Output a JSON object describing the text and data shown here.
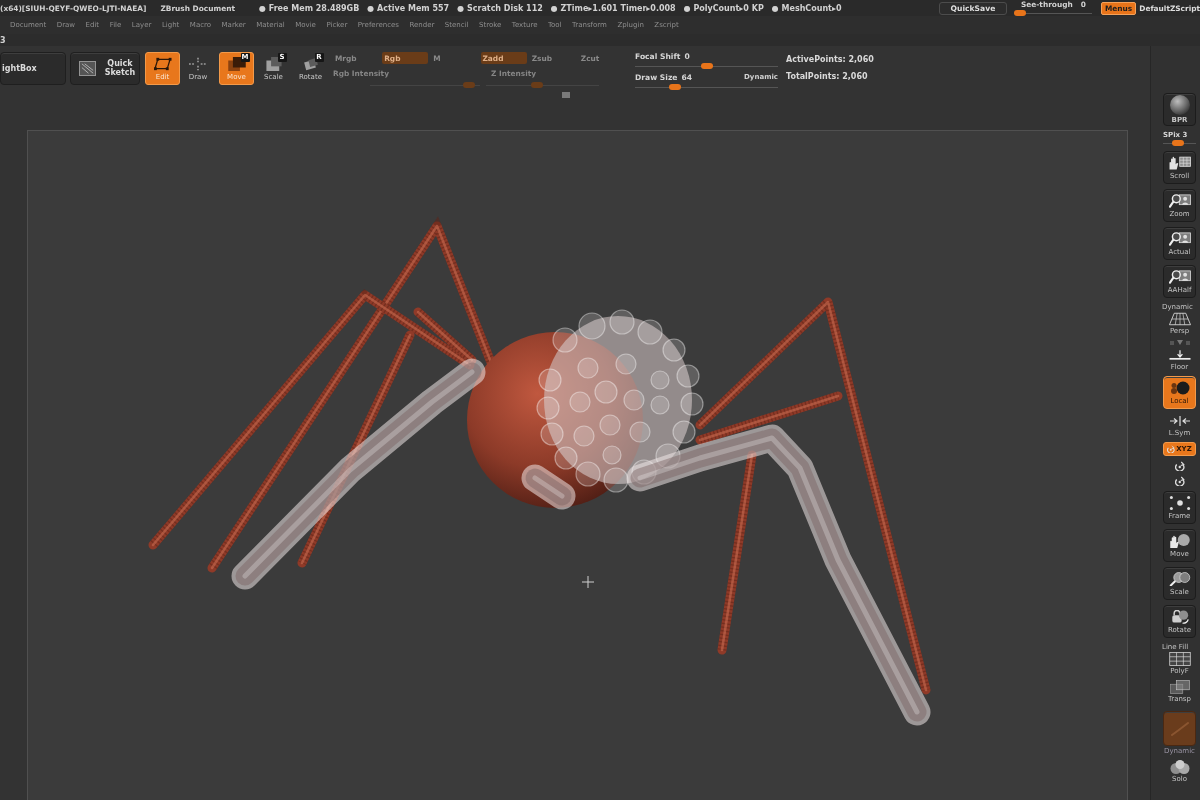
{
  "title_bar": {
    "license": "(x64)[SIUH-QEYF-QWEO-LJTI-NAEA]",
    "document": "ZBrush Document",
    "stats": [
      "● Free Mem 28.489GB",
      "● Active Mem 557",
      "● Scratch Disk 112",
      "● ZTime▸1.601 Timer▸0.008",
      "● PolyCount▸0 KP",
      "● MeshCount▸0"
    ],
    "quicksave": "QuickSave",
    "see_through": {
      "label": "See-through",
      "value": "0",
      "level": 0
    },
    "menus_toggle": {
      "label": "Menus",
      "on": true
    },
    "script": "DefaultZScript"
  },
  "menu_bar": {
    "items": [
      "Document",
      "Draw",
      "Edit",
      "File",
      "Layer",
      "Light",
      "Macro",
      "Marker",
      "Material",
      "Movie",
      "Picker",
      "Preferences",
      "Render",
      "Stencil",
      "Stroke",
      "Texture",
      "Tool",
      "Transform",
      "Zplugin",
      "Zscript"
    ]
  },
  "sub_palette": {
    "text": "3"
  },
  "toolbar": {
    "lightbox": "ightBox",
    "quick_sketch": "Quick Sketch",
    "modes": [
      {
        "kind": "edit",
        "label": "Edit",
        "selected": true
      },
      {
        "kind": "draw",
        "label": "Draw",
        "selected": false
      },
      {
        "kind": "move",
        "label": "Move",
        "hotkey": "M",
        "selected": true
      },
      {
        "kind": "scale",
        "label": "Scale",
        "hotkey": "S",
        "selected": false
      },
      {
        "kind": "rotate",
        "label": "Rotate",
        "hotkey": "R",
        "selected": false
      }
    ],
    "paint_group": {
      "disabled": true,
      "modes": [
        {
          "label": "Mrgb",
          "selected": false
        },
        {
          "label": "Rgb",
          "selected": true
        },
        {
          "label": "M",
          "selected": false
        },
        {
          "label": "Zadd",
          "selected": true
        },
        {
          "label": "Zsub",
          "selected": false
        },
        {
          "label": "Zcut",
          "selected": false
        }
      ],
      "sliders": [
        {
          "label": "Rgb Intensity",
          "level": 0.95
        },
        {
          "label": "Z Intensity",
          "level": 0.45
        }
      ]
    },
    "brush": {
      "focal_shift": {
        "label": "Focal Shift",
        "value": "0",
        "level": 0.5
      },
      "draw_size": {
        "label": "Draw Size",
        "value": "64",
        "level": 0.26
      },
      "dynamic": "Dynamic"
    },
    "points": [
      "ActivePoints: 2,060",
      "TotalPoints: 2,060"
    ]
  },
  "right_shelf": {
    "items": [
      {
        "kind": "render",
        "label": "BPR"
      },
      {
        "kind": "slider",
        "label": "SPix 3",
        "level": 0.45
      },
      {
        "kind": "scroll",
        "label": "Scroll"
      },
      {
        "kind": "zoom",
        "label": "Zoom"
      },
      {
        "kind": "actual",
        "label": "Actual"
      },
      {
        "kind": "aahalf",
        "label": "AAHalf"
      },
      {
        "kind": "persp",
        "caption": "Dynamic",
        "label": "Persp",
        "selected": false
      },
      {
        "kind": "floor",
        "label": "Floor",
        "selected": false
      },
      {
        "kind": "local",
        "label": "Local",
        "selected": true
      },
      {
        "kind": "lsym",
        "label": "L.Sym",
        "selected": false
      },
      {
        "kind": "xyz",
        "label": "XYZ",
        "selected": true
      },
      {
        "kind": "roty",
        "selected": false
      },
      {
        "kind": "rotz",
        "selected": false
      },
      {
        "kind": "frame",
        "label": "Frame"
      },
      {
        "kind": "move",
        "label": "Move"
      },
      {
        "kind": "scale",
        "label": "Scale"
      },
      {
        "kind": "rotate",
        "label": "Rotate"
      },
      {
        "kind": "polyf",
        "caption": "Line Fill",
        "label": "PolyF",
        "selected": false
      },
      {
        "kind": "transp",
        "label": "Transp",
        "selected": false
      },
      {
        "kind": "dynamic",
        "label": "Dynamic",
        "disabled": true
      },
      {
        "kind": "solo",
        "label": "Solo",
        "selected": false
      }
    ]
  }
}
